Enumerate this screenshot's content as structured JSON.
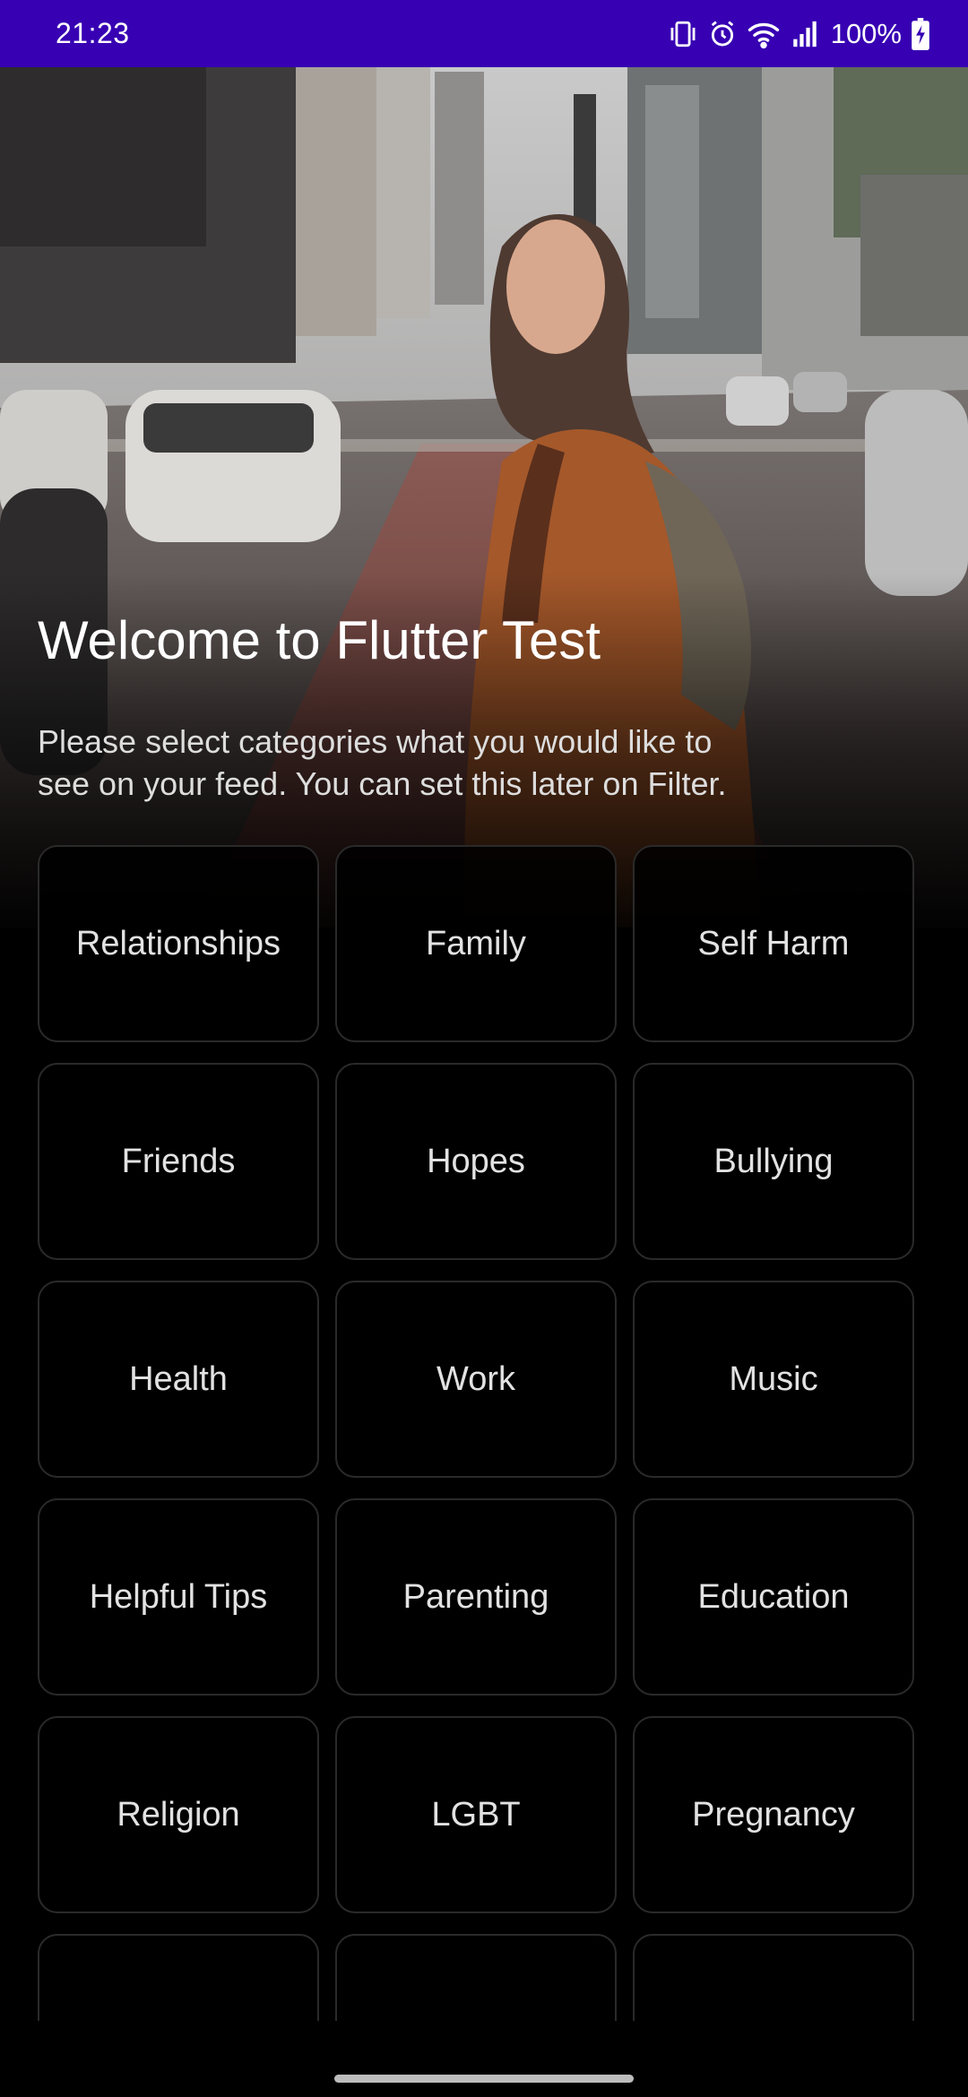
{
  "status_bar": {
    "time": "21:23",
    "battery": "100%",
    "icons": [
      "vibrate-icon",
      "alarm-icon",
      "wifi-icon",
      "signal-icon",
      "battery-charging-icon"
    ],
    "background": "#3700b3"
  },
  "welcome": {
    "title": "Welcome to Flutter Test",
    "subtitle": "Please select categories what you would like to\n see on your feed. You can set this later on Filter."
  },
  "categories": [
    "Relationships",
    "Family",
    "Self Harm",
    "Friends",
    "Hopes",
    "Bullying",
    "Health",
    "Work",
    "Music",
    "Helpful Tips",
    "Parenting",
    "Education",
    "Religion",
    "LGBT",
    "Pregnancy",
    "",
    "",
    ""
  ]
}
